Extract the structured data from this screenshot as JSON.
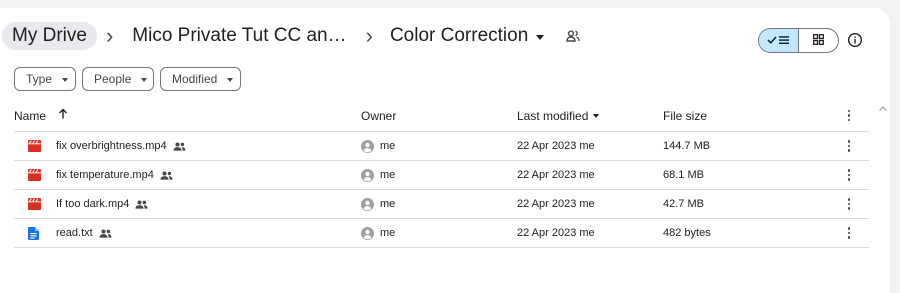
{
  "breadcrumb": {
    "root": "My Drive",
    "parent": "Mico Private Tut CC an…",
    "current": "Color Correction",
    "separator": "›"
  },
  "view_toggle": {
    "list_icon": "check-list-icon",
    "grid_icon": "grid-icon",
    "selected": "list"
  },
  "info_icon": "info-icon",
  "filters": [
    {
      "label": "Type"
    },
    {
      "label": "People"
    },
    {
      "label": "Modified"
    }
  ],
  "table": {
    "columns": {
      "name": "Name",
      "owner": "Owner",
      "last_modified": "Last modified",
      "file_size": "File size"
    },
    "sort": {
      "column": "name",
      "direction": "ascending"
    },
    "rows": [
      {
        "name": "fix overbrightness.mp4",
        "type": "video",
        "shared": true,
        "owner": "me",
        "modified": "22 Apr 2023 me",
        "size": "144.7 MB"
      },
      {
        "name": "fix temperature.mp4",
        "type": "video",
        "shared": true,
        "owner": "me",
        "modified": "22 Apr 2023 me",
        "size": "68.1 MB"
      },
      {
        "name": "If too dark.mp4",
        "type": "video",
        "shared": true,
        "owner": "me",
        "modified": "22 Apr 2023 me",
        "size": "42.7 MB"
      },
      {
        "name": "read.txt",
        "type": "document",
        "shared": true,
        "owner": "me",
        "modified": "22 Apr 2023 me",
        "size": "482 bytes"
      }
    ]
  },
  "colors": {
    "video_icon": "#d93025",
    "doc_icon": "#1a73e8",
    "toggle_selected": "#c2e7ff",
    "home_crumb_bg": "#e7e9ec"
  }
}
